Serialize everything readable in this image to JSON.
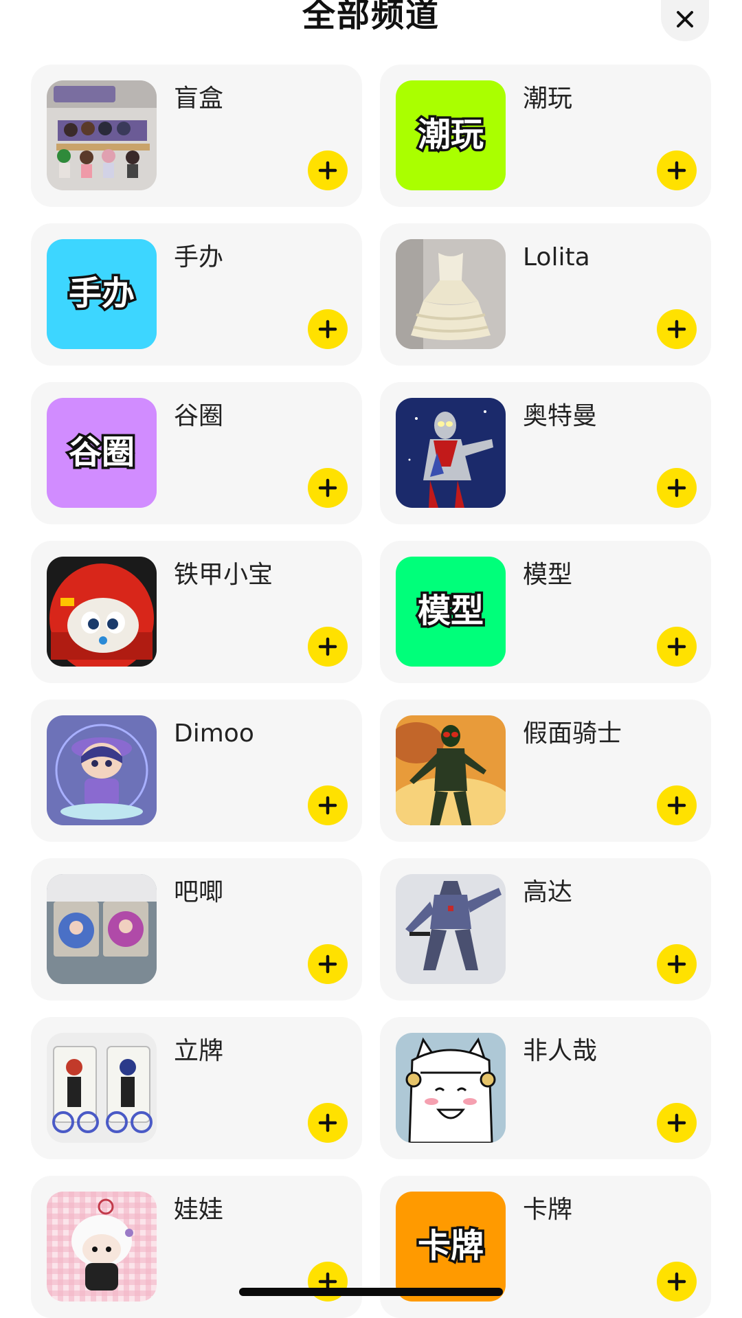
{
  "header": {
    "title": "全部频道",
    "close_icon": "close-icon"
  },
  "channels": [
    {
      "label": "盲盒",
      "thumb_icon": "blind-box-figures-photo"
    },
    {
      "label": "潮玩",
      "thumb_text": "潮玩",
      "thumb_color": "#aaff00"
    },
    {
      "label": "手办",
      "thumb_text": "手办",
      "thumb_color": "#3dd6ff"
    },
    {
      "label": "Lolita",
      "thumb_icon": "lolita-dress-photo"
    },
    {
      "label": "谷圈",
      "thumb_text": "谷圈",
      "thumb_color": "#d18cff"
    },
    {
      "label": "奥特曼",
      "thumb_icon": "ultraman-photo"
    },
    {
      "label": "铁甲小宝",
      "thumb_icon": "robot-toy-photo"
    },
    {
      "label": "模型",
      "thumb_text": "模型",
      "thumb_color": "#00ff7a"
    },
    {
      "label": "Dimoo",
      "thumb_icon": "dimoo-figure-photo"
    },
    {
      "label": "假面骑士",
      "thumb_icon": "kamen-rider-photo"
    },
    {
      "label": "吧唧",
      "thumb_icon": "badge-photo"
    },
    {
      "label": "高达",
      "thumb_icon": "gundam-photo"
    },
    {
      "label": "立牌",
      "thumb_icon": "acrylic-stand-photo"
    },
    {
      "label": "非人哉",
      "thumb_icon": "fei-ren-zai-character"
    },
    {
      "label": "娃娃",
      "thumb_icon": "plush-doll-photo"
    },
    {
      "label": "卡牌",
      "thumb_text": "卡牌",
      "thumb_color": "#ff9a00"
    }
  ],
  "add_icon": "plus-icon",
  "colors": {
    "accent": "#ffe100",
    "card_background": "#f6f6f6",
    "page_background": "#ffffff"
  }
}
